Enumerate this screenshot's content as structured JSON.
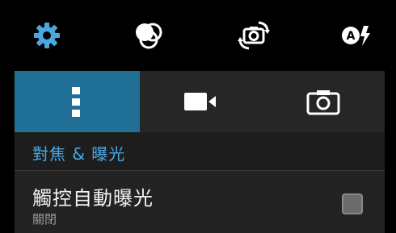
{
  "top_bar": {
    "icons": [
      "gear-icon",
      "color-effects-icon",
      "switch-camera-icon",
      "auto-flash-icon"
    ],
    "accent_color": "#4aa8e0"
  },
  "tabs": [
    {
      "name": "more-options",
      "icon": "vertical-dots-icon",
      "active": true
    },
    {
      "name": "video",
      "icon": "video-camera-icon",
      "active": false
    },
    {
      "name": "photo",
      "icon": "camera-icon",
      "active": false
    }
  ],
  "section": {
    "title": "對焦 & 曝光"
  },
  "setting": {
    "title": "觸控自動曝光",
    "status": "關閉",
    "checked": false
  }
}
